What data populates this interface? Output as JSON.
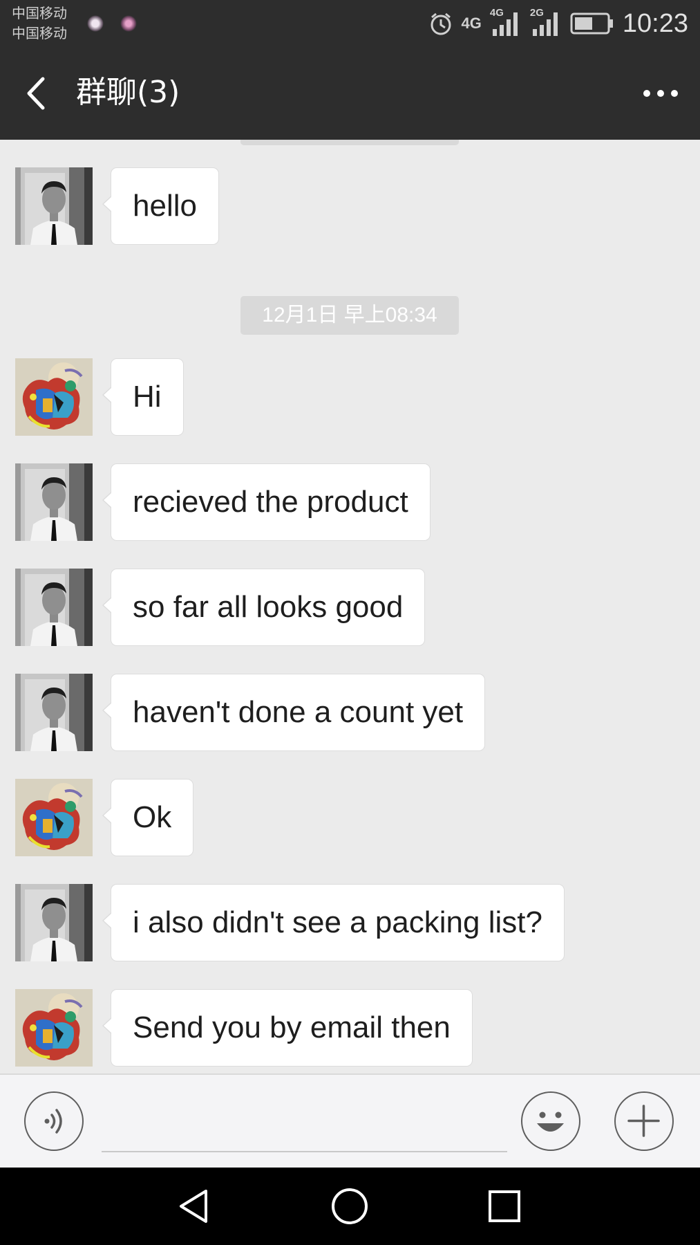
{
  "status_bar": {
    "carrier_1": "中国移动",
    "carrier_2": "中国移动",
    "network_1": "4G",
    "network_2": "4G",
    "network_3": "2G",
    "time": "10:23",
    "icons": [
      "alarm-icon",
      "signal-icon",
      "signal-icon",
      "battery-icon"
    ]
  },
  "header": {
    "title": "群聊(3)",
    "back_icon": "chevron-left-icon",
    "more_icon": "more-dots-icon"
  },
  "conversation": {
    "timestamp": "12月1日 早上08:34",
    "messages": [
      {
        "sender": "person",
        "text": "hello"
      },
      {
        "sender": "art",
        "text": "Hi"
      },
      {
        "sender": "person",
        "text": "recieved the product"
      },
      {
        "sender": "person",
        "text": "so far all looks good"
      },
      {
        "sender": "person",
        "text": "haven't done a count yet"
      },
      {
        "sender": "art",
        "text": "Ok"
      },
      {
        "sender": "person",
        "text": "i also didn't see a packing list?"
      },
      {
        "sender": "art",
        "text": "Send you by email then"
      }
    ]
  },
  "input_bar": {
    "voice_icon": "voice-icon",
    "emoji_icon": "emoji-icon",
    "plus_icon": "plus-icon",
    "placeholder": ""
  },
  "nav_bar": {
    "icons": [
      "nav-back-icon",
      "nav-home-icon",
      "nav-recents-icon"
    ]
  },
  "colors": {
    "header_bg": "#2d2d2d",
    "chat_bg": "#ebebeb",
    "bubble_bg": "#ffffff",
    "timestamp_bg": "#d9d9d9"
  }
}
